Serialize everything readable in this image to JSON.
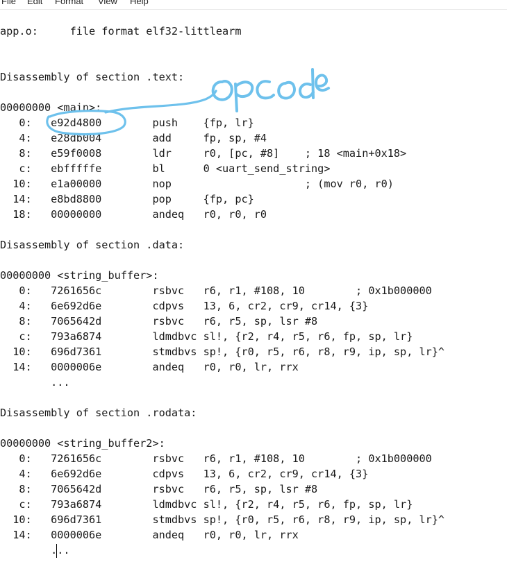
{
  "menu": {
    "items": [
      "File",
      "Edit",
      "Format",
      "View",
      "Help"
    ]
  },
  "editor": {
    "lines": [
      "app.o:     file format elf32-littlearm",
      "",
      "",
      "Disassembly of section .text:",
      "",
      "00000000 <main>:",
      "   0:   e92d4800        push    {fp, lr}",
      "   4:   e28db004        add     fp, sp, #4",
      "   8:   e59f0008        ldr     r0, [pc, #8]    ; 18 <main+0x18>",
      "   c:   ebfffffe        bl      0 <uart_send_string>",
      "  10:   e1a00000        nop                     ; (mov r0, r0)",
      "  14:   e8bd8800        pop     {fp, pc}",
      "  18:   00000000        andeq   r0, r0, r0",
      "",
      "Disassembly of section .data:",
      "",
      "00000000 <string_buffer>:",
      "   0:   7261656c        rsbvc   r6, r1, #108, 10        ; 0x1b000000",
      "   4:   6e692d6e        cdpvs   13, 6, cr2, cr9, cr14, {3}",
      "   8:   7065642d        rsbvc   r6, r5, sp, lsr #8",
      "   c:   793a6874        ldmdbvc sl!, {r2, r4, r5, r6, fp, sp, lr}",
      "  10:   696d7361        stmdbvs sp!, {r0, r5, r6, r8, r9, ip, sp, lr}^",
      "  14:   0000006e        andeq   r0, r0, lr, rrx",
      "        ...",
      "",
      "Disassembly of section .rodata:",
      "",
      "00000000 <string_buffer2>:",
      "   0:   7261656c        rsbvc   r6, r1, #108, 10        ; 0x1b000000",
      "   4:   6e692d6e        cdpvs   13, 6, cr2, cr9, cr14, {3}",
      "   8:   7065642d        rsbvc   r6, r5, sp, lsr #8",
      "   c:   793a6874        ldmdbvc sl!, {r2, r4, r5, r6, fp, sp, lr}",
      "  10:   696d7361        stmdbvs sp!, {r0, r5, r6, r8, r9, ip, sp, lr}^",
      "  14:   0000006e        andeq   r0, r0, lr, rrx",
      "        ..."
    ]
  },
  "annotation": {
    "text": "opcode",
    "color": "#6ec1ec"
  }
}
